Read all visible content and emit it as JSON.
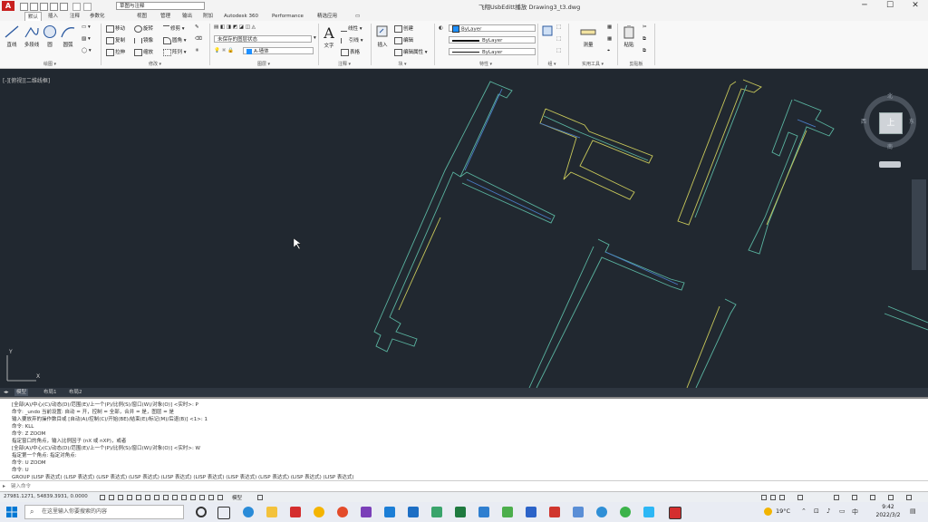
{
  "window": {
    "title": "飞翔UsbEditt播放    Drawing3_t3.dwg",
    "logo": "A"
  },
  "workspace": {
    "selected": "草图与注释"
  },
  "tabs": [
    "默认",
    "插入",
    "注释",
    "参数化",
    "视图",
    "管理",
    "输出",
    "附加",
    "Autodesk 360",
    "Performance",
    "精选应用",
    "▭"
  ],
  "ribbon": {
    "draw": {
      "line": "直线",
      "polyline": "多段线",
      "circle": "圆",
      "arc": "圆弧",
      "panel": "绘图 ▾"
    },
    "modify": {
      "move": "移动",
      "rotate": "旋转",
      "trim": "修剪",
      "copy": "复制",
      "mirror": "镜像",
      "fillet": "圆角",
      "stretch": "拉伸",
      "scale": "缩放",
      "array": "阵列",
      "panel": "修改 ▾"
    },
    "layers": {
      "state": "未保存的图层状态",
      "current": "A-墙体",
      "panel": "图层 ▾"
    },
    "annotation": {
      "text": "文字",
      "linear": "线性",
      "leader": "引线",
      "table": "表格",
      "panel": "注释 ▾"
    },
    "block": {
      "insert": "插入",
      "create": "创建",
      "edit": "编辑",
      "editattr": "编辑属性",
      "panel": "块 ▾"
    },
    "properties": {
      "color": "ByLayer",
      "linetype": "ByLayer",
      "lineweight": "ByLayer",
      "panel": "特性 ▾"
    },
    "groups": {
      "panel": "组 ▾"
    },
    "utilities": {
      "measure": "测量",
      "panel": "实用工具 ▾"
    },
    "clipboard": {
      "paste": "粘贴",
      "panel": "剪贴板"
    }
  },
  "viewport": {
    "label": "[-][俯视][二维线框]"
  },
  "viewcube": {
    "face": "上",
    "n": "北",
    "s": "南",
    "w": "西",
    "e": "东",
    "wcs": "WCS"
  },
  "layout_tabs": [
    "模型",
    "布局1",
    "布局2"
  ],
  "command_history": [
    "[全部(A)/中心(C)/动态(D)/范围(E)/上一个(P)/比例(S)/窗口(W)/对象(O)] <实时>: P",
    "命令: _undo 当前设置: 自动 = 开，控制 = 全部，合并 = 是，图层 = 是",
    "输入要放弃的操作数目或 [自动(A)/控制(C)/开始(BE)/结束(E)/标记(M)/后退(B)] <1>: 1",
    "命令: KLL",
    "命令: Z ZOOM",
    "指定窗口的角点，输入比例因子 (nX 或 nXP)，或者",
    "[全部(A)/中心(C)/动态(D)/范围(E)/上一个(P)/比例(S)/窗口(W)/对象(O)] <实时>: W",
    "指定第一个角点: 指定对角点:",
    "命令: U ZOOM",
    "命令: U",
    "GROUP (LISP 表达式) (LISP 表达式) (LISP 表达式) (LISP 表达式) (LISP 表达式) (LISP 表达式) (LISP 表达式) (LISP 表达式) (LISP 表达式) (LISP 表达式)"
  ],
  "command_input": {
    "placeholder": "键入命令"
  },
  "statusbar": {
    "coords": "27981.1271, 54839.3931, 0.0000",
    "model": "模型"
  },
  "taskbar": {
    "search_placeholder": "在这里输入你要搜索的内容",
    "weather": "19°C",
    "time": "9:42",
    "date": "2022/3/2"
  },
  "colors": {
    "background": "#212830",
    "wall_yellow": "#c8c85a",
    "wall_cyan": "#5ab4a0",
    "wall_blue": "#4a7cc8"
  }
}
